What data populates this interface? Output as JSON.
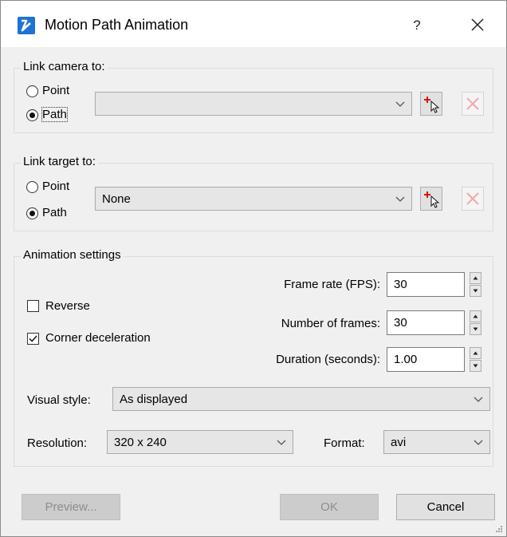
{
  "window": {
    "title": "Motion Path Animation",
    "help": "?"
  },
  "camera": {
    "label": "Link camera to:",
    "point_label": "Point",
    "path_label": "Path",
    "selected": "path",
    "combo_value": ""
  },
  "target": {
    "label": "Link target to:",
    "point_label": "Point",
    "path_label": "Path",
    "selected": "path",
    "combo_value": "None"
  },
  "settings": {
    "label": "Animation settings",
    "reverse_label": "Reverse",
    "reverse_checked": false,
    "corner_label": "Corner deceleration",
    "corner_checked": true,
    "frame_rate_label": "Frame rate (FPS):",
    "frame_rate_value": "30",
    "frames_label": "Number of frames:",
    "frames_value": "30",
    "duration_label": "Duration (seconds):",
    "duration_value": "1.00",
    "visual_style_label": "Visual style:",
    "visual_style_value": "As displayed",
    "resolution_label": "Resolution:",
    "resolution_value": "320 x 240",
    "format_label": "Format:",
    "format_value": "avi"
  },
  "buttons": {
    "preview": "Preview...",
    "ok": "OK",
    "cancel": "Cancel"
  },
  "colors": {
    "accent": "#0078d7",
    "app_icon": "#1e73d2",
    "disabled_x": "#f2a7a7"
  }
}
